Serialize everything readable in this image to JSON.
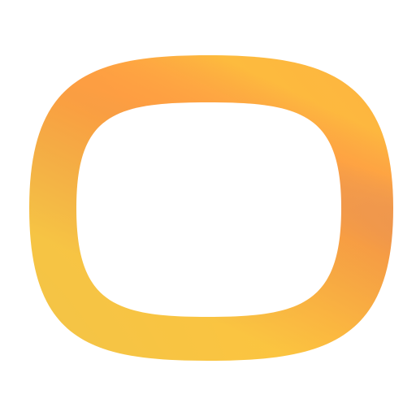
{
  "logo": {
    "name": "gradient-rounded-square-ring-icon",
    "gradient": {
      "stops": [
        "#1EB4F0",
        "#FDC13C",
        "#FF4D5E"
      ],
      "inner_stops": [
        "#FFB63A",
        "#FFC53D"
      ]
    },
    "background_color": "#FFFFFF"
  }
}
